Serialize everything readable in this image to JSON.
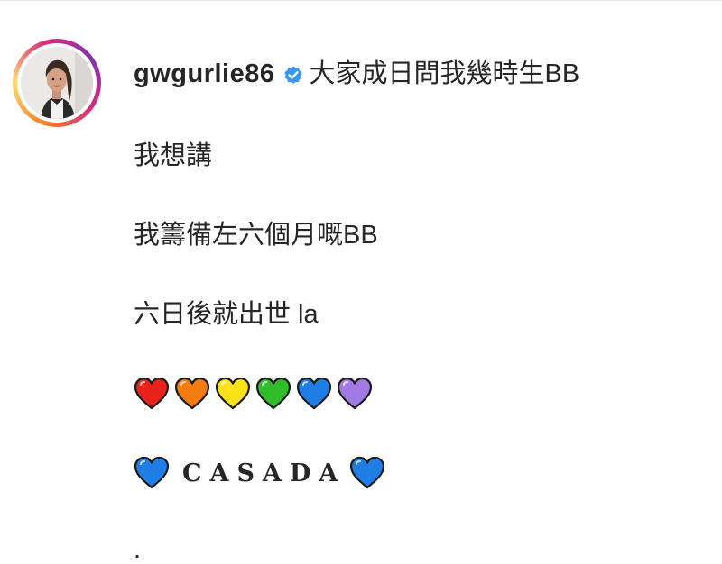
{
  "post": {
    "username": "gwgurlie86",
    "verified": true,
    "caption_lines": [
      "大家成日問我幾時生BB",
      "我想講",
      "我籌備左六個月嘅BB",
      "六日後就出世 la"
    ],
    "hearts": [
      {
        "icon": "red-heart-icon",
        "color": "#e8221a"
      },
      {
        "icon": "orange-heart-icon",
        "color": "#f47a12"
      },
      {
        "icon": "yellow-heart-icon",
        "color": "#fde21a"
      },
      {
        "icon": "green-heart-icon",
        "color": "#2fbe2a"
      },
      {
        "icon": "blue-heart-icon",
        "color": "#1f7ee6"
      },
      {
        "icon": "purple-heart-icon",
        "color": "#a27ae6"
      }
    ],
    "casada_text": "CASADA",
    "casada_heart_color": "#1f7ee6",
    "trailing_text": "."
  },
  "colors": {
    "text": "#262626",
    "verified_badge": "#3897f0"
  }
}
